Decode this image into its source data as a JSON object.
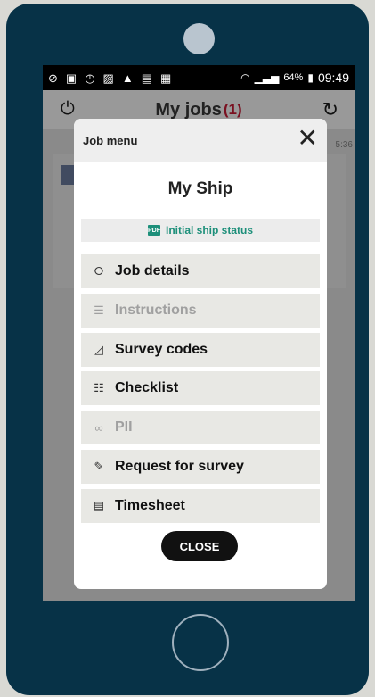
{
  "status_bar": {
    "icons": [
      "silent-icon",
      "picture-icon",
      "alarm-icon",
      "cast-icon",
      "warning-icon",
      "briefcase-check-icon",
      "briefcase-icon"
    ],
    "battery_percent": "64%",
    "time": "09:49"
  },
  "app_bar": {
    "title": "My jobs",
    "count": "(1)"
  },
  "background": {
    "time_fragment": "5:36"
  },
  "dialog": {
    "header_title": "Job menu",
    "ship_name": "My Ship",
    "status_label": "Initial ship status",
    "pdf_badge": "PDF",
    "menu_items": [
      {
        "label": "Job details",
        "icon": "tag-icon",
        "enabled": true
      },
      {
        "label": "Instructions",
        "icon": "document-icon",
        "enabled": false
      },
      {
        "label": "Survey codes",
        "icon": "triangle-ruler-icon",
        "enabled": true
      },
      {
        "label": "Checklist",
        "icon": "checklist-icon",
        "enabled": true
      },
      {
        "label": "PII",
        "icon": "binoculars-icon",
        "enabled": false
      },
      {
        "label": "Request for survey",
        "icon": "edit-note-icon",
        "enabled": true
      },
      {
        "label": "Timesheet",
        "icon": "timesheet-icon",
        "enabled": true
      }
    ],
    "close_label": "CLOSE"
  },
  "colors": {
    "phone_frame": "#073247",
    "accent_teal": "#1d8f7a",
    "count_red": "#7a1020"
  }
}
